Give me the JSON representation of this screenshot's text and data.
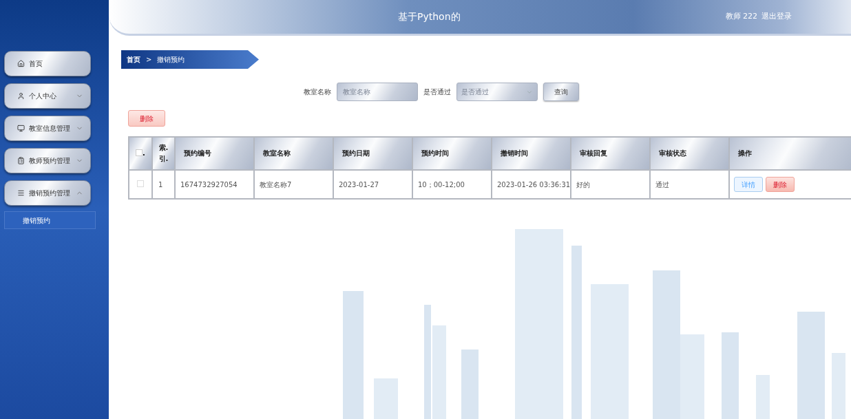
{
  "header": {
    "title": "基于Python的",
    "user": "教师 222",
    "logout": "退出登录"
  },
  "sidebar": {
    "items": [
      {
        "label": "首页",
        "kind": "link"
      },
      {
        "label": "个人中心",
        "kind": "menu",
        "expanded": false
      },
      {
        "label": "教室信息管理",
        "kind": "menu",
        "expanded": false
      },
      {
        "label": "教师预约管理",
        "kind": "menu",
        "expanded": false
      },
      {
        "label": "撤销预约管理",
        "kind": "menu",
        "expanded": true,
        "children": [
          {
            "label": "撤销预约",
            "selected": true
          }
        ]
      }
    ]
  },
  "breadcrumb": {
    "home": "首页",
    "separator": ">",
    "current": "撤销预约"
  },
  "search": {
    "fields": [
      {
        "label": "教室名称",
        "placeholder": "教室名称",
        "kind": "input"
      },
      {
        "label": "是否通过",
        "placeholder": "是否通过",
        "kind": "select"
      }
    ],
    "button": "查询"
  },
  "delete_button": "删除",
  "table": {
    "select_all": {
      "checked": false,
      "label": "."
    },
    "columns": [
      "索.\n引.",
      "预约编号",
      "教室名称",
      "预约日期",
      "预约时间",
      "撤销时间",
      "审核回复",
      "审核状态",
      "操作"
    ],
    "rows": [
      {
        "checked": false,
        "cells": [
          "1",
          "1674732927054",
          "教室名称7",
          "2023-01-27",
          "10；00-12;00",
          "2023-01-26 03:36:31",
          "好的",
          "通过"
        ],
        "actions": [
          {
            "label": "详情",
            "kind": "info"
          },
          {
            "label": "删除",
            "kind": "danger"
          }
        ]
      }
    ]
  }
}
